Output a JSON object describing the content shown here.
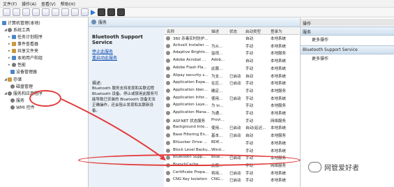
{
  "menu": [
    "文件(F)",
    "操作(A)",
    "查看(V)",
    "帮助(H)"
  ],
  "tree": {
    "root": "计算机管理(本地)",
    "system_tools": "系统工具",
    "task_scheduler": "任务计划程序",
    "event_viewer": "事件查看器",
    "shared_folders": "共享文件夹",
    "local_users": "本地用户和组",
    "performance": "性能",
    "device_manager": "设备管理器",
    "storage": "存储",
    "disk_management": "磁盘管理",
    "services_apps": "服务和应用程序",
    "services": "服务",
    "wmi": "WMI 控件"
  },
  "panel": {
    "header": "服务",
    "selected_service": "Bluetooth Support Service",
    "stop_link": "停止此服务",
    "restart_link": "重启动此服务",
    "desc_label": "描述:",
    "description": "Bluetooth 服务支持发现和关联远程 Bluetooth 设备。停止或禁用此服务可能导致已安装的 Bluetooth 设备无法正确操作，还会阻止发现和关联新设备。"
  },
  "table": {
    "headers": [
      "名称",
      "描述",
      "状态",
      "启动类型",
      "登录为"
    ],
    "rows": [
      [
        "360 杀毒实时防护...",
        "",
        "",
        "自动",
        "本地系统"
      ],
      [
        "ActiveX Installer ...",
        "为从...",
        "",
        "手动",
        "本地系统"
      ],
      [
        "Adaptive Brightn...",
        "监视...",
        "",
        "手动",
        "本地服务"
      ],
      [
        "Adobe Acrobat ...",
        "Adob...",
        "",
        "自动",
        "本地系统"
      ],
      [
        "Adobe Flash Pla...",
        "此服...",
        "",
        "手动",
        "本地系统"
      ],
      [
        "Alipay security s...",
        "为支...",
        "已启动",
        "自动",
        "本地系统"
      ],
      [
        "Application Expe...",
        "在应...",
        "已启动",
        "手动",
        "本地系统"
      ],
      [
        "Application Iden...",
        "确定...",
        "",
        "手动",
        "本地服务"
      ],
      [
        "Application Infor...",
        "使用...",
        "已启动",
        "手动",
        "本地系统"
      ],
      [
        "Application Laye...",
        "为 In...",
        "",
        "手动",
        "本地服务"
      ],
      [
        "Application Mana...",
        "为通...",
        "",
        "手动",
        "本地系统"
      ],
      [
        "ASP.NET 状态服务",
        "Provi...",
        "",
        "手动",
        "网络服务"
      ],
      [
        "Background Inte...",
        "使用...",
        "已启动",
        "自动(延迟...",
        "本地系统"
      ],
      [
        "Base Filtering En...",
        "基本...",
        "已启动",
        "自动",
        "本地服务"
      ],
      [
        "BitLocker Drive ...",
        "BDE...",
        "",
        "手动",
        "本地系统"
      ],
      [
        "Block Level Backu...",
        "Wind...",
        "",
        "手动",
        "本地系统"
      ],
      [
        "Bluetooth Supp...",
        "Blue...",
        "已启动",
        "手动",
        "本地服务"
      ],
      [
        "BranchCache",
        "此服...",
        "",
        "手动",
        "网络服务"
      ],
      [
        "Certificate Propa...",
        "将用...",
        "已启动",
        "手动",
        "本地系统"
      ],
      [
        "CNG Key Isolation",
        "CNG...",
        "已启动",
        "手动",
        "本地系统"
      ]
    ]
  },
  "actions": {
    "header": "操作",
    "section1": "服务",
    "more1": "更多操作",
    "section2": "Bluetooth Support Service",
    "more2": "更多操作"
  },
  "watermark": "网管爱好者",
  "colors": {
    "highlight_circle": "#e23a3a",
    "link": "#0645ad"
  }
}
